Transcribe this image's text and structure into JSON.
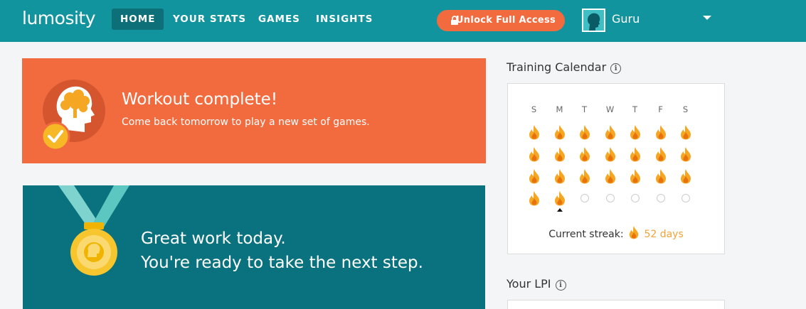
{
  "nav": {
    "logo": "lumosity",
    "tabs": [
      {
        "label": "HOME",
        "active": true
      },
      {
        "label": "YOUR STATS",
        "active": false
      },
      {
        "label": "GAMES",
        "active": false
      },
      {
        "label": "INSIGHTS",
        "active": false
      }
    ],
    "unlock_label": "Unlock Full Access",
    "user_name": "Guru"
  },
  "workout": {
    "title": "Workout complete!",
    "subtitle": "Come back tomorrow to play a new set of games."
  },
  "next_step": {
    "line1": "Great work today.",
    "line2": "You're ready to take the next step."
  },
  "calendar": {
    "heading": "Training Calendar",
    "info_glyph": "i",
    "days": [
      "S",
      "M",
      "T",
      "W",
      "T",
      "F",
      "S"
    ],
    "completed_count": 23,
    "today_index": 22,
    "total_cells": 28,
    "streak_label": "Current streak:",
    "streak_value": "52 days"
  },
  "lpi": {
    "heading": "Your LPI",
    "info_glyph": "i"
  },
  "colors": {
    "nav_bg": "#12949f",
    "nav_active": "#0d6f78",
    "accent_orange": "#f26b3f",
    "teal_card": "#09727e",
    "flame_outer": "#f5a623",
    "flame_inner": "#e8720c",
    "medal_gold": "#f7c52e",
    "ribbon": "#5cc6c0"
  },
  "icons": {
    "lock": "lock-icon",
    "avatar": "avatar-silhouette",
    "caret": "chevron-down-icon",
    "brain_head": "brain-head-icon",
    "check": "check-icon",
    "medal": "medal-icon",
    "flame": "flame-icon",
    "info": "info-icon"
  }
}
